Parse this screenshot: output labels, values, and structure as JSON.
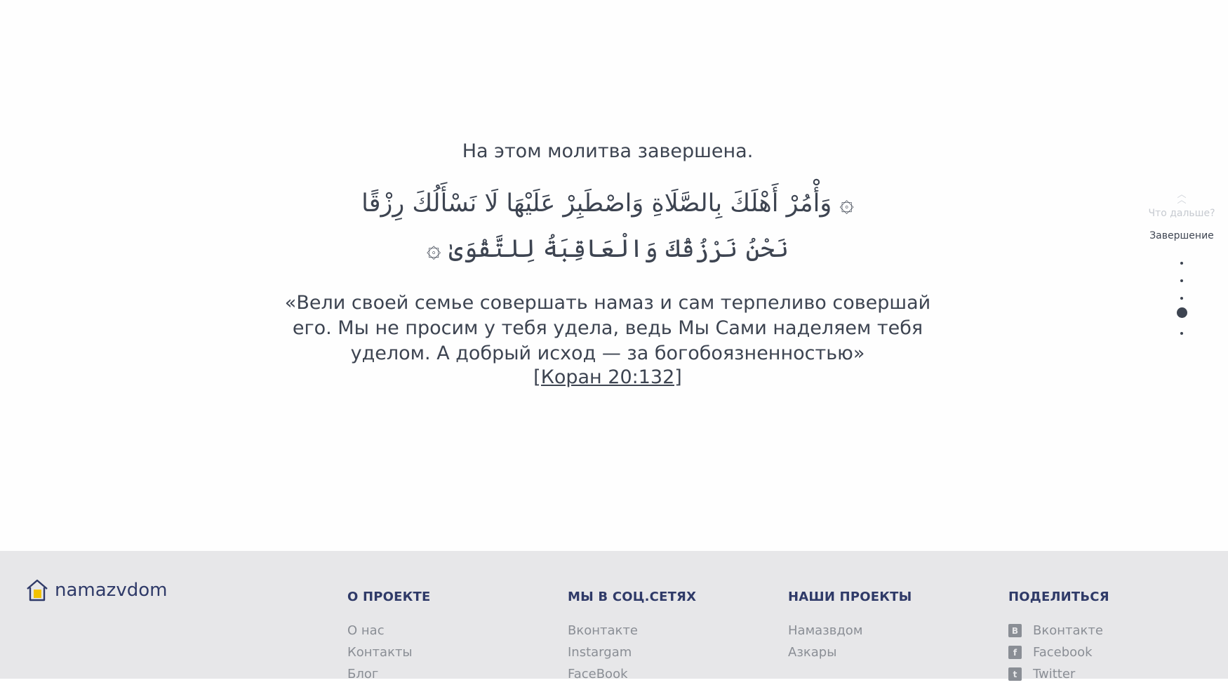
{
  "main": {
    "heading": "На этом молитва завершена.",
    "arabic_line1": "۞ وَأْمُرْ أَهْلَكَ بِالصَّلَاةِ وَاصْطَبِرْ عَلَيْهَا لَا نَسْأَلُكَ رِزْقًا",
    "arabic_line2": "نَحْنُ نَرْزُقُكَ وَالْعَاقِبَةُ لِلتَّقْوَىٰ ۞",
    "quote_line1": "«Вели своей семье совершать намаз и сам терпеливо совершай",
    "quote_line2": "его. Мы не просим у тебя удела, ведь Мы Сами наделяем тебя",
    "quote_line3": "уделом. А добрый исход — за богобоязненностью»",
    "reference": "[Коран 20:132]"
  },
  "sidenav": {
    "next_label": "Что дальше?",
    "current_label": "Завершение",
    "active_index": 3,
    "dot_count": 5
  },
  "footer": {
    "logo_text": "namazvdom",
    "logo_color": "#2f3a68",
    "accent_color": "#f2c200",
    "columns": [
      {
        "title": "О ПРОЕКТЕ",
        "links": [
          "О нас",
          "Контакты",
          "Блог"
        ]
      },
      {
        "title": "МЫ В СОЦ.СЕТЯХ",
        "links": [
          "Вконтакте",
          "Instargam",
          "FaceBook"
        ]
      },
      {
        "title": "НАШИ ПРОЕКТЫ",
        "links": [
          "Намазвдом",
          "Азкары"
        ]
      },
      {
        "title": "ПОДЕЛИТЬСЯ",
        "links": [
          {
            "icon": "vk-icon",
            "glyph": "B",
            "label": "Вконтакте"
          },
          {
            "icon": "facebook-icon",
            "glyph": "f",
            "label": "Facebook"
          },
          {
            "icon": "twitter-icon",
            "glyph": "t",
            "label": "Twitter"
          }
        ]
      }
    ]
  }
}
